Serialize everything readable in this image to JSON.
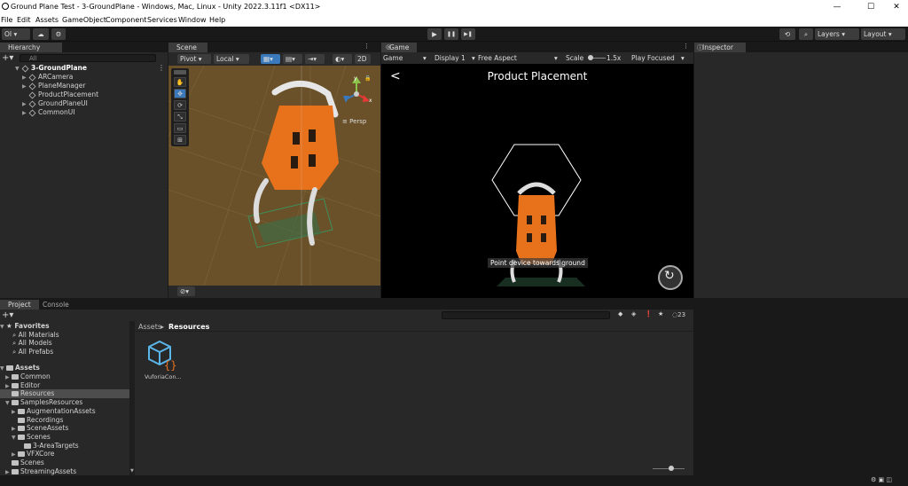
{
  "window": {
    "title": "Ground Plane Test - 3-GroundPlane - Windows, Mac, Linux - Unity 2022.3.11f1 <DX11>",
    "min": "—",
    "max": "☐",
    "close": "✕"
  },
  "menu": [
    "File",
    "Edit",
    "Assets",
    "GameObject",
    "Component",
    "Services",
    "Window",
    "Help"
  ],
  "toolbar": {
    "account": "OI ▾",
    "layers": "Layers",
    "layout": "Layout",
    "play": "▶",
    "pause": "❚❚",
    "step": "▶❚"
  },
  "hierarchy": {
    "tab": "Hierarchy",
    "search_placeholder": "All",
    "scene": "3-GroundPlane",
    "items": [
      "ARCamera",
      "PlaneManager",
      "ProductPlacement",
      "GroundPlaneUI",
      "CommonUI"
    ]
  },
  "scene": {
    "tab": "Scene",
    "pivot": "Pivot",
    "local": "Local",
    "mode2d": "2D",
    "persp": "Persp",
    "gizmo_x": "x",
    "gizmo_y": "y"
  },
  "game": {
    "tab": "Game",
    "display_mode": "Game",
    "display": "Display 1",
    "aspect": "Free Aspect",
    "scale_label": "Scale",
    "scale_value": "1.5x",
    "play_focused": "Play Focused",
    "screen_title": "Product Placement",
    "back": "<",
    "hint": "Point device towards ground"
  },
  "inspector": {
    "tab": "Inspector"
  },
  "project": {
    "tab": "Project",
    "console_tab": "Console",
    "hidden_count": "23",
    "breadcrumb_root": "Assets",
    "breadcrumb_sep": "▸",
    "breadcrumb_current": "Resources",
    "favorites": {
      "label": "Favorites",
      "items": [
        "All Materials",
        "All Models",
        "All Prefabs"
      ]
    },
    "assets": {
      "label": "Assets",
      "items": [
        {
          "label": "Common",
          "depth": 1,
          "arrow": "▶"
        },
        {
          "label": "Editor",
          "depth": 1,
          "arrow": "▶"
        },
        {
          "label": "Resources",
          "depth": 1,
          "arrow": ""
        },
        {
          "label": "SamplesResources",
          "depth": 1,
          "arrow": "▼"
        },
        {
          "label": "AugmentationAssets",
          "depth": 2,
          "arrow": "▶"
        },
        {
          "label": "Recordings",
          "depth": 2,
          "arrow": ""
        },
        {
          "label": "SceneAssets",
          "depth": 2,
          "arrow": "▶"
        },
        {
          "label": "Scenes",
          "depth": 2,
          "arrow": "▼"
        },
        {
          "label": "3-AreaTargets",
          "depth": 3,
          "arrow": ""
        },
        {
          "label": "VFXCore",
          "depth": 2,
          "arrow": "▶"
        },
        {
          "label": "Scenes",
          "depth": 1,
          "arrow": ""
        },
        {
          "label": "StreamingAssets",
          "depth": 1,
          "arrow": "▶"
        }
      ]
    },
    "files": [
      {
        "label": "VuforiaCon..."
      }
    ]
  },
  "colors": {
    "selection": "#4d4d4d",
    "accent": "#3a79bb",
    "orange": "#e8711c"
  }
}
